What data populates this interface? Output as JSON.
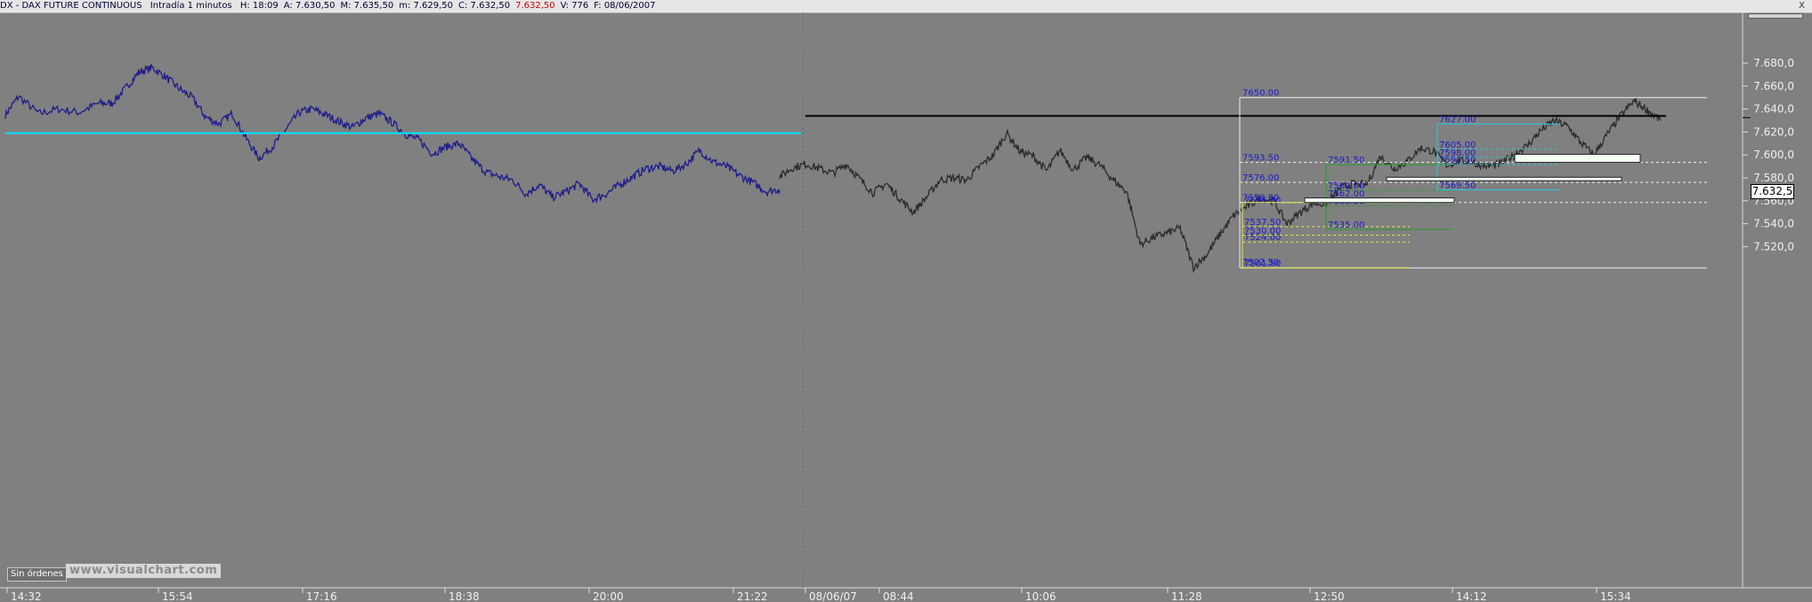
{
  "header": {
    "symbol": "DX - DAX FUTURE CONTINUOUS",
    "timeframe": "Intradía 1 minutos",
    "fields": [
      {
        "text": "H: 18:09",
        "color": "dark"
      },
      {
        "text": "A: 7.630,50",
        "color": "dark"
      },
      {
        "text": "M: 7.635,50",
        "color": "dark"
      },
      {
        "text": "m: 7.629,50",
        "color": "dark"
      },
      {
        "text": "C: 7.632,50",
        "color": "dark"
      },
      {
        "text": "7.632,50",
        "color": "red"
      },
      {
        "text": "V: 776",
        "color": "dark"
      },
      {
        "text": "F: 08/06/2007",
        "color": "dark"
      }
    ],
    "close": "X"
  },
  "price_tag": "7.632,5",
  "orders_label": "Sin órdenes",
  "watermark": "www.visualchart.com",
  "colors": {
    "background": "#808080",
    "series_previous": "#1c1c8c",
    "series_current": "#2a2a2a",
    "level_cyan": "#00e5ff",
    "level_black": "#000000",
    "fib_label": "#1a1acc",
    "box_white": "#f0f0f0",
    "box_green": "#22a022",
    "box_yellow": "#e6e64d",
    "box_cyan": "#22c8e6"
  },
  "y_axis": {
    "ticks": [
      {
        "value": 7680,
        "label": "7.680,0"
      },
      {
        "value": 7660,
        "label": "7.660,0"
      },
      {
        "value": 7640,
        "label": "7.640,0"
      },
      {
        "value": 7620,
        "label": "7.620,0"
      },
      {
        "value": 7600,
        "label": "7.600,0"
      },
      {
        "value": 7580,
        "label": "7.580,0"
      },
      {
        "value": 7560,
        "label": "7.560,0"
      },
      {
        "value": 7540,
        "label": "7.540,0"
      },
      {
        "value": 7520,
        "label": "7.520,0"
      }
    ]
  },
  "x_axis": {
    "ticks": [
      "14:32",
      "15:54",
      "17:16",
      "18:38",
      "20:00",
      "21:22",
      "08/06/07",
      "08:44",
      "10:06",
      "11:28",
      "12:50",
      "14:12",
      "15:34"
    ]
  },
  "levels": {
    "cyan_line": 7619,
    "black_line": 7634,
    "current_price": 7632.5
  },
  "fib_labels": [
    "7650.00",
    "7593.50",
    "7576.00",
    "7558.50",
    "7556.50",
    "7537.50",
    "7530.00",
    "7524.00",
    "7502.50",
    "7501.50",
    "7591.50",
    "7569.00",
    "7562.00",
    "7555.50",
    "7535.00",
    "7627.00",
    "7605.00",
    "7598.00",
    "7591.50",
    "7569.50"
  ],
  "series_keypoints": {
    "previous_day": [
      [
        0,
        7635
      ],
      [
        10,
        7651
      ],
      [
        25,
        7636
      ],
      [
        40,
        7640
      ],
      [
        55,
        7637
      ],
      [
        70,
        7645
      ],
      [
        80,
        7645
      ],
      [
        90,
        7658
      ],
      [
        100,
        7672
      ],
      [
        110,
        7676
      ],
      [
        120,
        7668
      ],
      [
        130,
        7658
      ],
      [
        140,
        7650
      ],
      [
        150,
        7633
      ],
      [
        160,
        7627
      ],
      [
        170,
        7636
      ],
      [
        180,
        7615
      ],
      [
        190,
        7597
      ],
      [
        200,
        7607
      ],
      [
        210,
        7622
      ],
      [
        220,
        7637
      ],
      [
        230,
        7640
      ],
      [
        240,
        7635
      ],
      [
        250,
        7629
      ],
      [
        260,
        7624
      ],
      [
        270,
        7632
      ],
      [
        280,
        7636
      ],
      [
        290,
        7628
      ],
      [
        300,
        7618
      ],
      [
        310,
        7613
      ],
      [
        320,
        7601
      ],
      [
        330,
        7607
      ],
      [
        340,
        7610
      ],
      [
        350,
        7596
      ],
      [
        360,
        7585
      ],
      [
        370,
        7581
      ],
      [
        380,
        7578
      ],
      [
        390,
        7566
      ],
      [
        400,
        7574
      ],
      [
        410,
        7563
      ],
      [
        420,
        7568
      ],
      [
        430,
        7575
      ],
      [
        440,
        7561
      ],
      [
        450,
        7566
      ],
      [
        460,
        7574
      ],
      [
        470,
        7581
      ],
      [
        480,
        7588
      ],
      [
        490,
        7590
      ],
      [
        500,
        7586
      ],
      [
        510,
        7592
      ],
      [
        520,
        7604
      ],
      [
        530,
        7594
      ],
      [
        540,
        7590
      ],
      [
        550,
        7582
      ],
      [
        560,
        7576
      ],
      [
        570,
        7568
      ],
      [
        580,
        7570
      ]
    ],
    "current_day": [
      [
        580,
        7581
      ],
      [
        590,
        7589
      ],
      [
        600,
        7592
      ],
      [
        610,
        7588
      ],
      [
        620,
        7584
      ],
      [
        630,
        7592
      ],
      [
        640,
        7579
      ],
      [
        650,
        7567
      ],
      [
        660,
        7575
      ],
      [
        670,
        7562
      ],
      [
        680,
        7550
      ],
      [
        690,
        7563
      ],
      [
        700,
        7578
      ],
      [
        710,
        7580
      ],
      [
        720,
        7578
      ],
      [
        730,
        7590
      ],
      [
        740,
        7600
      ],
      [
        750,
        7619
      ],
      [
        760,
        7603
      ],
      [
        770,
        7599
      ],
      [
        780,
        7586
      ],
      [
        790,
        7604
      ],
      [
        800,
        7587
      ],
      [
        810,
        7598
      ],
      [
        820,
        7591
      ],
      [
        830,
        7578
      ],
      [
        840,
        7568
      ],
      [
        850,
        7522
      ],
      [
        860,
        7528
      ],
      [
        870,
        7532
      ],
      [
        880,
        7536
      ],
      [
        890,
        7502
      ],
      [
        900,
        7513
      ],
      [
        910,
        7531
      ],
      [
        920,
        7547
      ],
      [
        930,
        7555
      ],
      [
        940,
        7562
      ],
      [
        950,
        7560
      ],
      [
        960,
        7540
      ],
      [
        970,
        7550
      ],
      [
        980,
        7558
      ],
      [
        990,
        7557
      ],
      [
        1000,
        7571
      ],
      [
        1010,
        7575
      ],
      [
        1020,
        7574
      ],
      [
        1030,
        7599
      ],
      [
        1040,
        7588
      ],
      [
        1050,
        7594
      ],
      [
        1060,
        7606
      ],
      [
        1070,
        7603
      ],
      [
        1080,
        7591
      ],
      [
        1090,
        7595
      ],
      [
        1100,
        7593
      ],
      [
        1110,
        7590
      ],
      [
        1120,
        7592
      ],
      [
        1130,
        7600
      ],
      [
        1140,
        7608
      ],
      [
        1150,
        7621
      ],
      [
        1160,
        7630
      ],
      [
        1170,
        7625
      ],
      [
        1180,
        7611
      ],
      [
        1190,
        7600
      ],
      [
        1200,
        7618
      ],
      [
        1210,
        7634
      ],
      [
        1220,
        7647
      ],
      [
        1230,
        7639
      ],
      [
        1240,
        7630
      ]
    ]
  }
}
